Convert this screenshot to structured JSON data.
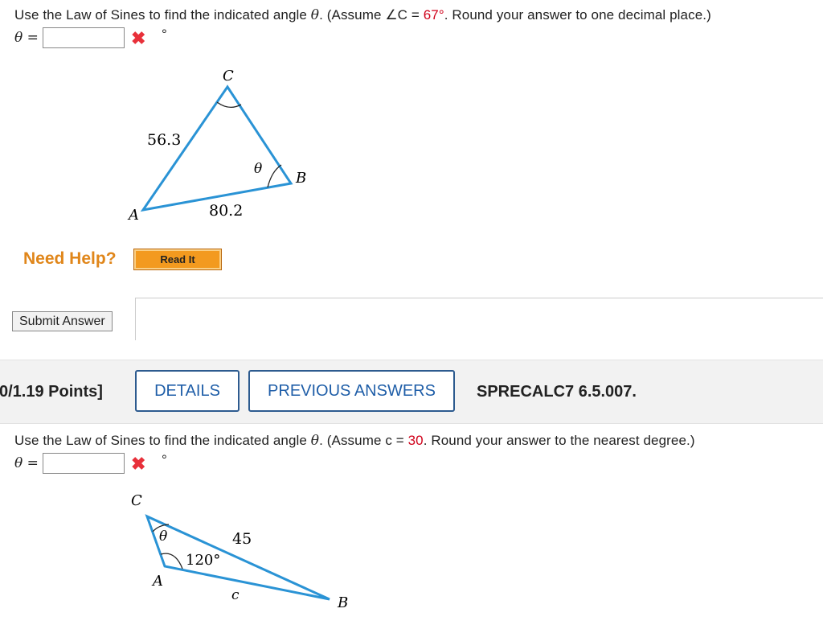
{
  "q1": {
    "prompt_before": "Use the Law of Sines to find the indicated angle ",
    "prompt_theta": "θ",
    "prompt_middle": ". (Assume ∠C = ",
    "given_value": "67°",
    "prompt_after": ". Round your answer to one decimal place.)",
    "answer_label": "θ =",
    "answer_value": "",
    "degree_symbol": "°",
    "status_icon": "x-mark-icon",
    "figure": {
      "vertex_a": "A",
      "vertex_b": "B",
      "vertex_c": "C",
      "side_ac": "56.3",
      "side_ab": "80.2",
      "angle_b": "θ"
    }
  },
  "help": {
    "label": "Need Help?",
    "read_it": "Read It"
  },
  "submit": {
    "label": "Submit Answer"
  },
  "q2_header": {
    "points": "0/1.19 Points]",
    "details": "DETAILS",
    "previous_answers": "PREVIOUS ANSWERS",
    "code": "SPRECALC7 6.5.007."
  },
  "q2": {
    "prompt_before": "Use the Law of Sines to find the indicated angle ",
    "prompt_theta": "θ",
    "prompt_middle": ". (Assume c = ",
    "given_value": "30",
    "prompt_after": ". Round your answer to the nearest degree.)",
    "answer_label": "θ =",
    "answer_value": "",
    "degree_symbol": "°",
    "status_icon": "x-mark-icon",
    "figure": {
      "vertex_a": "A",
      "vertex_b": "B",
      "vertex_c": "C",
      "side_cb": "45",
      "side_ab": "c",
      "angle_a": "120°",
      "angle_c": "θ"
    }
  },
  "colors": {
    "triangle": "#2a93d5",
    "accent_red": "#d0021b",
    "help_orange": "#e0861a",
    "tab_blue": "#1f5ea8"
  }
}
